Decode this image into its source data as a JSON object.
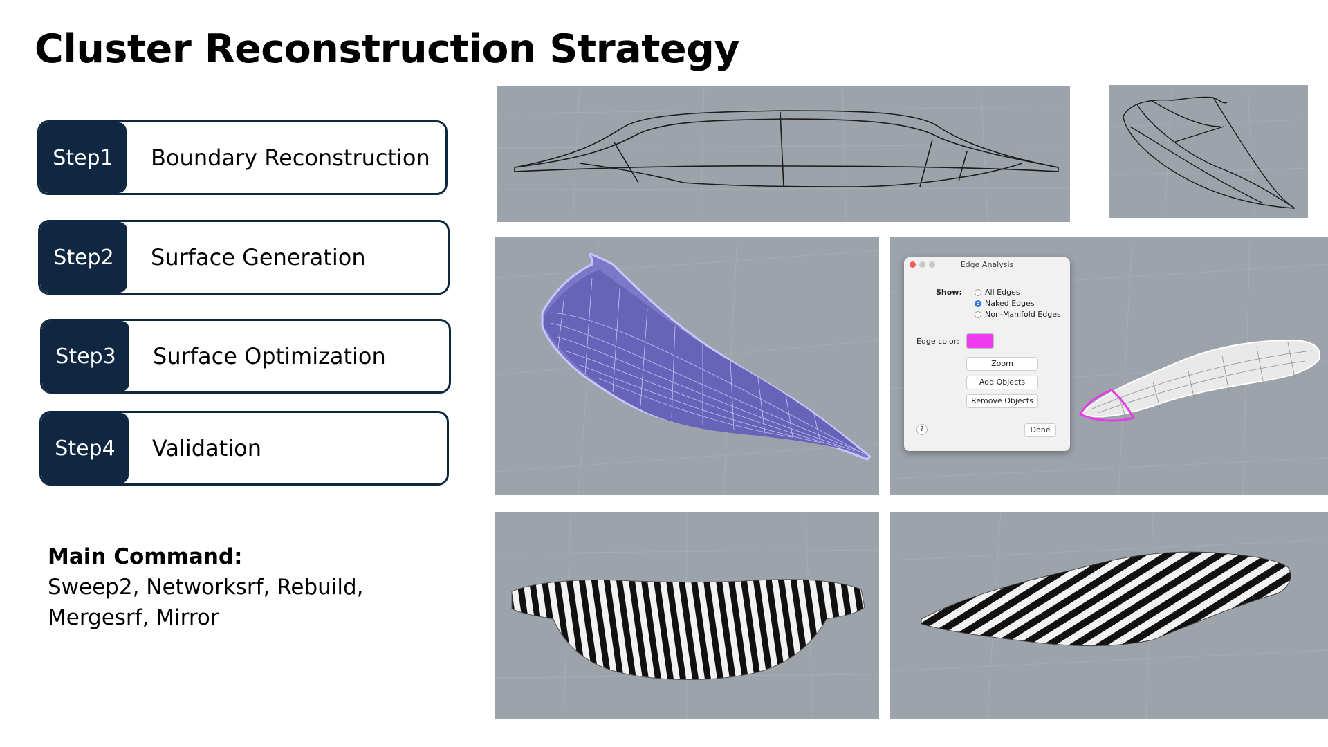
{
  "title": "Cluster Reconstruction Strategy",
  "steps": [
    {
      "num": "Step1",
      "label": "Boundary Reconstruction"
    },
    {
      "num": "Step2",
      "label": "Surface Generation"
    },
    {
      "num": "Step3",
      "label": "Surface Optimization"
    },
    {
      "num": "Step4",
      "label": "Validation"
    }
  ],
  "main_command": {
    "heading": "Main Command:",
    "line1": "Sweep2, Networksrf, Rebuild,",
    "line2": "Mergesrf, Mirror"
  },
  "edge_dialog": {
    "title": "Edge Analysis",
    "show_label": "Show:",
    "options": [
      "All Edges",
      "Naked Edges",
      "Non-Manifold Edges"
    ],
    "selected": "Naked Edges",
    "edge_color_label": "Edge color:",
    "edge_color": "#f03cf0",
    "buttons": [
      "Zoom",
      "Add Objects",
      "Remove Objects"
    ],
    "help": "?",
    "done": "Done"
  },
  "colors": {
    "navy": "#0f2740",
    "viewport": "#9da3ab",
    "surface_purple": "#a9a6ee",
    "naked_edge": "#e43ce6"
  }
}
